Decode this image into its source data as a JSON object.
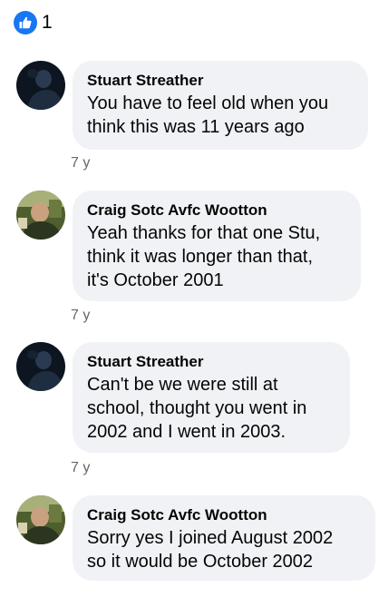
{
  "reactions": {
    "icon": "like-icon",
    "color": "#1877f2",
    "count": "1"
  },
  "comments": [
    {
      "author": "Stuart Streather",
      "lines": [
        "You have to feel old when you",
        "think this was 11 years ago"
      ],
      "time": "7 y"
    },
    {
      "author": "Craig Sotc Avfc Wootton",
      "lines": [
        "Yeah thanks for that one Stu,",
        "think it was longer than that,",
        "it's October 2001"
      ],
      "time": "7 y"
    },
    {
      "author": "Stuart Streather",
      "lines": [
        "Can't be we were still at",
        "school, thought you went in",
        "2002 and I went in 2003."
      ],
      "time": "7 y"
    },
    {
      "author": "Craig Sotc Avfc Wootton",
      "lines": [
        "Sorry yes I joined August 2002",
        "so it would be October 2002"
      ]
    }
  ],
  "colors": {
    "bubble": "#f0f2f5",
    "meta_text": "#65676b"
  }
}
